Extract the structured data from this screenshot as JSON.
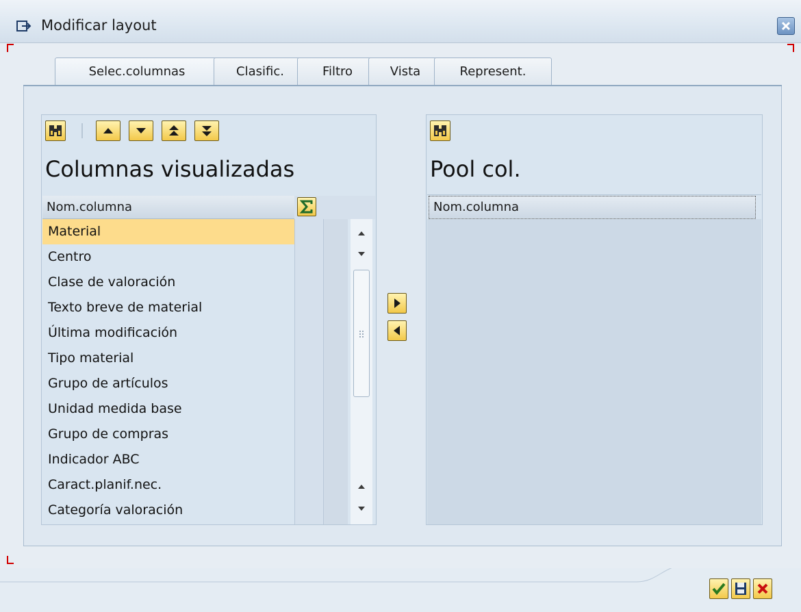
{
  "window": {
    "title": "Modificar layout"
  },
  "tabs": [
    {
      "label": "Selec.columnas",
      "active": true
    },
    {
      "label": "Clasific.",
      "active": false
    },
    {
      "label": "Filtro",
      "active": false
    },
    {
      "label": "Vista",
      "active": false
    },
    {
      "label": "Represent.",
      "active": false
    }
  ],
  "displayed": {
    "heading": "Columnas visualizadas",
    "column_header": "Nom.columna",
    "rows": [
      {
        "label": "Material",
        "selected": true
      },
      {
        "label": "Centro",
        "selected": false
      },
      {
        "label": "Clase de valoración",
        "selected": false
      },
      {
        "label": "Texto breve de material",
        "selected": false
      },
      {
        "label": "Última modificación",
        "selected": false
      },
      {
        "label": "Tipo material",
        "selected": false
      },
      {
        "label": "Grupo de artículos",
        "selected": false
      },
      {
        "label": "Unidad medida base",
        "selected": false
      },
      {
        "label": "Grupo de compras",
        "selected": false
      },
      {
        "label": "Indicador ABC",
        "selected": false
      },
      {
        "label": "Caract.planif.nec.",
        "selected": false
      },
      {
        "label": "Categoría valoración",
        "selected": false
      }
    ]
  },
  "pool": {
    "heading": "Pool col.",
    "column_header": "Nom.columna"
  },
  "icons": {
    "title": "window-layout-icon",
    "find": "binoculars-icon",
    "move_up": "arrow-up-icon",
    "move_down": "arrow-down-icon",
    "move_top": "arrow-top-icon",
    "move_bottom": "arrow-bottom-icon",
    "sum": "sigma-icon",
    "move_right": "arrow-right-icon",
    "move_left": "arrow-left-icon",
    "confirm": "checkmark-icon",
    "save": "save-icon",
    "cancel": "cancel-icon"
  },
  "colors": {
    "selection": "#fddc8c",
    "button_yellow": "#f3c94a",
    "panel_bg": "#d9e5f0",
    "close_red": "#d10000"
  }
}
